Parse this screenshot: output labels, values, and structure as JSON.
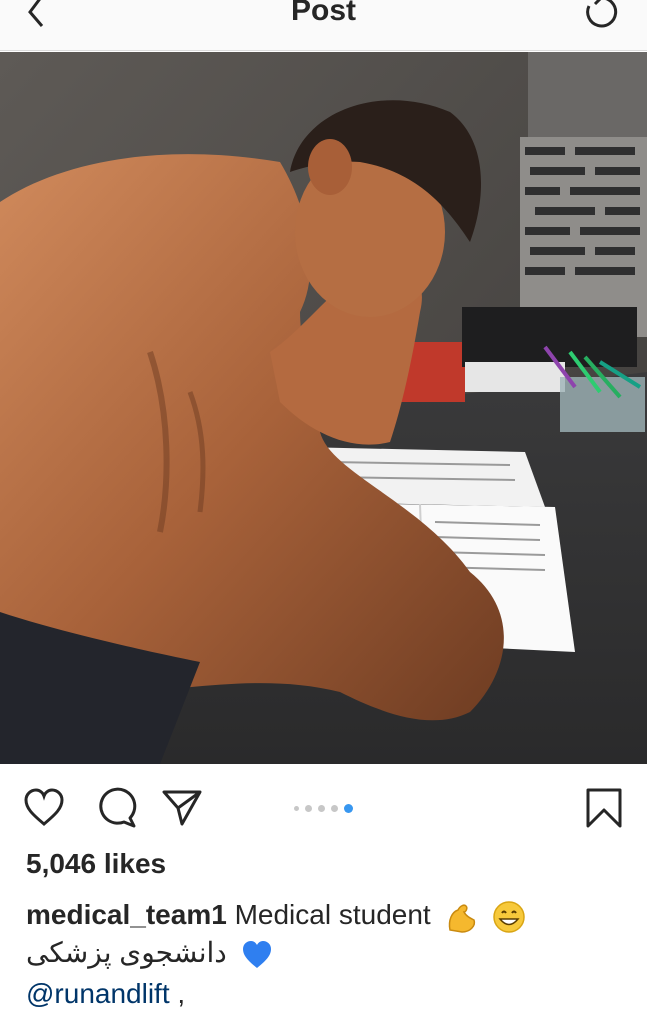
{
  "header": {
    "title": "Post",
    "back_icon": "chevron-left-icon",
    "refresh_icon": "refresh-icon"
  },
  "post": {
    "image_alt": "Shirtless muscular man leaning over an open book at a kitchen counter",
    "carousel": {
      "count": 5,
      "active_index": 4
    },
    "likes": "5,046 likes",
    "username": "medical_team1",
    "caption_text": "Medical student",
    "caption_emojis": [
      "flexed-biceps-emoji",
      "smiling-face-emoji"
    ],
    "caption_line2": "دانشجوی پزشکی",
    "caption_line2_emoji": "blue-heart-emoji",
    "mention": "@runandlift",
    "mention_suffix": " ,"
  },
  "colors": {
    "accent": "#3897f0",
    "mention": "#003569",
    "text": "#262626"
  }
}
